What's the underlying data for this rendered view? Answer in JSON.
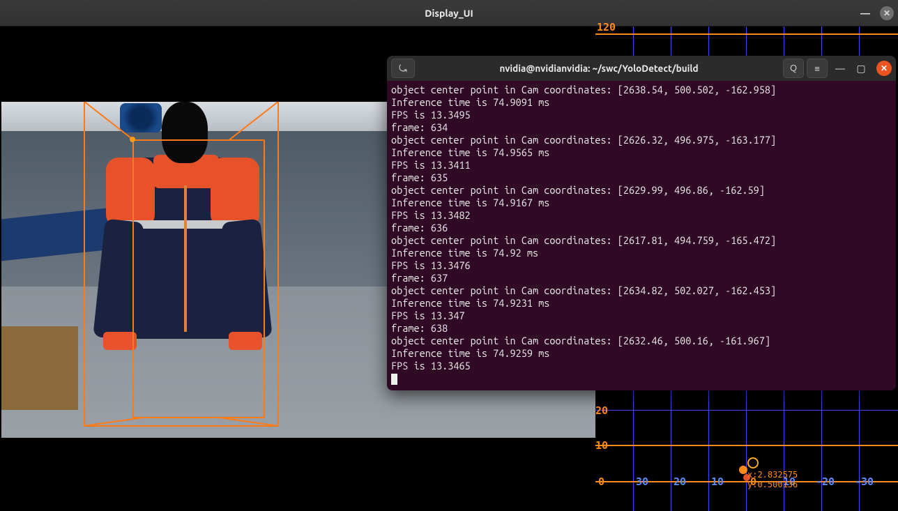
{
  "display_window": {
    "title": "Display_UI"
  },
  "terminal_window": {
    "title": "nvidia@nvidianvidia: ~/swc/YoloDetect/build",
    "lines": [
      "object center point in Cam coordinates: [2638.54, 500.502, -162.958]",
      "Inference time is 74.9091 ms",
      "FPS is 13.3495",
      "frame: 634",
      "object center point in Cam coordinates: [2626.32, 496.975, -163.177]",
      "Inference time is 74.9565 ms",
      "FPS is 13.3411",
      "frame: 635",
      "object center point in Cam coordinates: [2629.99, 496.86, -162.59]",
      "Inference time is 74.9167 ms",
      "FPS is 13.3482",
      "frame: 636",
      "object center point in Cam coordinates: [2617.81, 494.759, -165.472]",
      "Inference time is 74.92 ms",
      "FPS is 13.3476",
      "frame: 637",
      "object center point in Cam coordinates: [2634.82, 502.027, -162.453]",
      "Inference time is 74.9231 ms",
      "FPS is 13.347",
      "frame: 638",
      "object center point in Cam coordinates: [2632.46, 500.16, -161.967]",
      "Inference time is 74.9259 ms",
      "FPS is 13.3465"
    ]
  },
  "chart": {
    "top_tick": "120",
    "y_ticks": [
      "20",
      "10",
      "0"
    ],
    "x_ticks": [
      "30",
      "20",
      "10",
      "0",
      "-10",
      "-20",
      "-30"
    ],
    "point_label_x": "x:2.832575",
    "point_label_y": "y:0.500136"
  },
  "icons": {
    "new_tab": "⤿",
    "search": "Q",
    "menu": "≡",
    "minimize": "—",
    "maximize": "▢",
    "close": "✕"
  }
}
